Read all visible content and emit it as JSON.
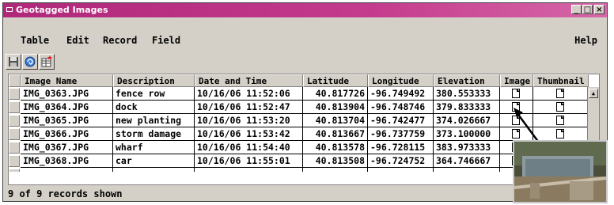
{
  "window": {
    "title": "Geotagged Images",
    "controls": {
      "minimize": "_",
      "maximize": "□",
      "close": "×"
    }
  },
  "menubar": {
    "items": [
      "Table",
      "Edit",
      "Record",
      "Field"
    ],
    "help": "Help"
  },
  "toolbar": {
    "icons": [
      "save-icon",
      "refresh-icon",
      "insert-record-icon"
    ]
  },
  "table": {
    "columns": [
      "Image Name",
      "Description",
      "Date and Time",
      "Latitude",
      "Longitude",
      "Elevation",
      "Image",
      "Thumbnail"
    ],
    "rows": [
      [
        "IMG_0363.JPG",
        "fence row",
        "10/16/06 11:52:06",
        "40.817726",
        "-96.749492",
        "380.553333"
      ],
      [
        "IMG_0364.JPG",
        "dock",
        "10/16/06 11:52:47",
        "40.813904",
        "-96.748746",
        "379.833333"
      ],
      [
        "IMG_0365.JPG",
        "new planting",
        "10/16/06 11:53:20",
        "40.813704",
        "-96.742477",
        "374.026667"
      ],
      [
        "IMG_0366.JPG",
        "storm damage",
        "10/16/06 11:53:42",
        "40.813667",
        "-96.737759",
        "373.100000"
      ],
      [
        "IMG_0367.JPG",
        "wharf",
        "10/16/06 11:54:40",
        "40.813578",
        "-96.728115",
        "383.973333"
      ],
      [
        "IMG_0368.JPG",
        "car",
        "10/16/06 11:55:01",
        "40.813508",
        "-96.724752",
        "364.746667"
      ]
    ]
  },
  "status": {
    "text": "9 of 9 records shown"
  },
  "colors": {
    "title_bar": "#b0287a",
    "window_bg": "#d4d0c8"
  }
}
